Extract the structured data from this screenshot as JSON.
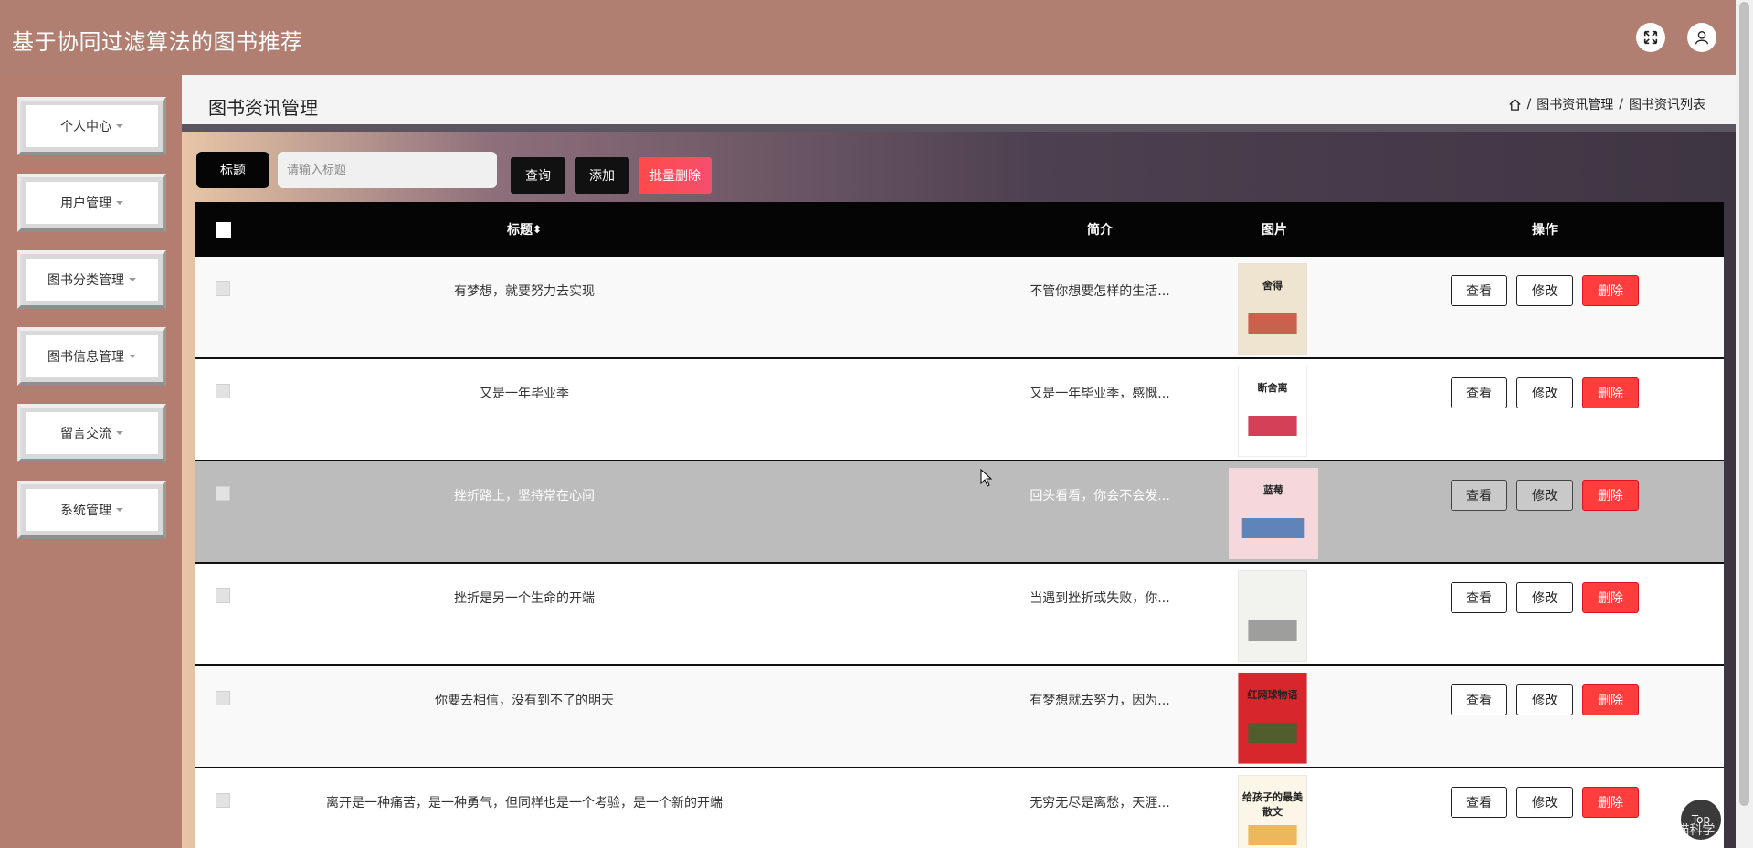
{
  "app": {
    "title": "基于协同过滤算法的图书推荐"
  },
  "header": {
    "icons": [
      "fullscreen-icon",
      "user-icon"
    ]
  },
  "sidebar": {
    "items": [
      {
        "label": "个人中心"
      },
      {
        "label": "用户管理"
      },
      {
        "label": "图书分类管理"
      },
      {
        "label": "图书信息管理"
      },
      {
        "label": "留言交流"
      },
      {
        "label": "系统管理"
      }
    ]
  },
  "page": {
    "title": "图书资讯管理",
    "breadcrumb": [
      "图书资讯管理",
      "图书资讯列表"
    ]
  },
  "search": {
    "label": "标题",
    "placeholder": "请输入标题",
    "query_label": "查询",
    "add_label": "添加",
    "batch_delete_label": "批量删除"
  },
  "table": {
    "headers": {
      "title": "标题",
      "sort_icon": "⬍",
      "intro": "简介",
      "image": "图片",
      "ops": "操作"
    },
    "ops": {
      "view": "查看",
      "edit": "修改",
      "delete": "删除"
    },
    "rows": [
      {
        "title": "有梦想，就要努力去实现",
        "intro": "不管你想要怎样的生活...",
        "cover_text": "舍得",
        "cover_color": "#efe4cf",
        "cover_accent": "#c0402a"
      },
      {
        "title": "又是一年毕业季",
        "intro": "又是一年毕业季，感慨...",
        "cover_text": "断舍离",
        "cover_color": "#ffffff",
        "cover_accent": "#c8102e"
      },
      {
        "title": "挫折路上，坚持常在心间",
        "intro": "回头看看，你会不会发...",
        "cover_text": "蓝莓",
        "cover_color": "#f6d8dc",
        "cover_accent": "#3a6fb0"
      },
      {
        "title": "挫折是另一个生命的开端",
        "intro": "当遇到挫折或失败，你...",
        "cover_text": "",
        "cover_color": "#f2f2ee",
        "cover_accent": "#888"
      },
      {
        "title": "你要去相信，没有到不了的明天",
        "intro": "有梦想就去努力，因为...",
        "cover_text": "红网球物语",
        "cover_color": "#d7262c",
        "cover_accent": "#2f6b2d"
      },
      {
        "title": "离开是一种痛苦，是一种勇气，但同样也是一个考验，是一个新的开端",
        "intro": "无穷无尽是离愁，天涯...",
        "cover_text": "给孩子的最美散文",
        "cover_color": "#fbf6e8",
        "cover_accent": "#e8a93a"
      }
    ]
  },
  "floating": {
    "top_label": "Top",
    "watermark": "CSDN @升瞄科学"
  }
}
